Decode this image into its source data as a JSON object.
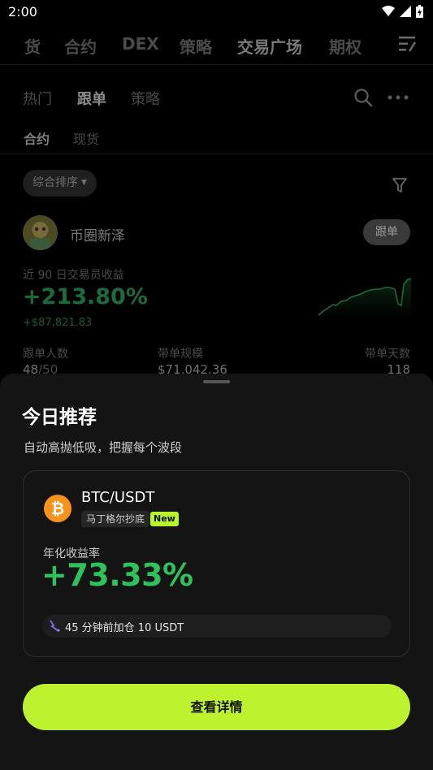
{
  "status_bar": {
    "time": "2:00"
  },
  "top_nav": {
    "items": [
      {
        "label": "货"
      },
      {
        "label": "合约"
      },
      {
        "label": "DEX"
      },
      {
        "label": "策略"
      },
      {
        "label": "交易广场",
        "active": true
      },
      {
        "label": "期权"
      }
    ]
  },
  "sub_nav": {
    "items": [
      {
        "label": "热门"
      },
      {
        "label": "跟单",
        "active": true
      },
      {
        "label": "策略"
      }
    ]
  },
  "market_tabs": {
    "items": [
      {
        "label": "合约",
        "active": true
      },
      {
        "label": "现货"
      }
    ]
  },
  "sort": {
    "label": "综合排序"
  },
  "trader": {
    "name": "币圈新泽",
    "follow_label": "跟单",
    "profit_label": "近 90 日交易员收益",
    "profit_pct": "+213.80%",
    "profit_abs": "+$87,821.83",
    "stats": [
      {
        "label": "跟单人数",
        "value": "48",
        "value_suffix": "/50"
      },
      {
        "label": "带单规模",
        "value": "$71,042.36"
      },
      {
        "label": "带单天数",
        "value": "118"
      }
    ]
  },
  "sheet": {
    "title": "今日推荐",
    "subtitle": "自动高抛低吸，把握每个波段",
    "card": {
      "pair": "BTC/USDT",
      "strategy_tag": "马丁格尔抄底",
      "new_badge": "New",
      "apy_label": "年化收益率",
      "apy_value": "+73.33%",
      "activity": "45 分钟前加仓 10 USDT"
    },
    "cta_label": "查看详情"
  },
  "colors": {
    "accent": "#bdf22e",
    "profit_green": "#2fc25b",
    "btc_orange": "#f7931a",
    "sheet_bg": "#141414"
  }
}
